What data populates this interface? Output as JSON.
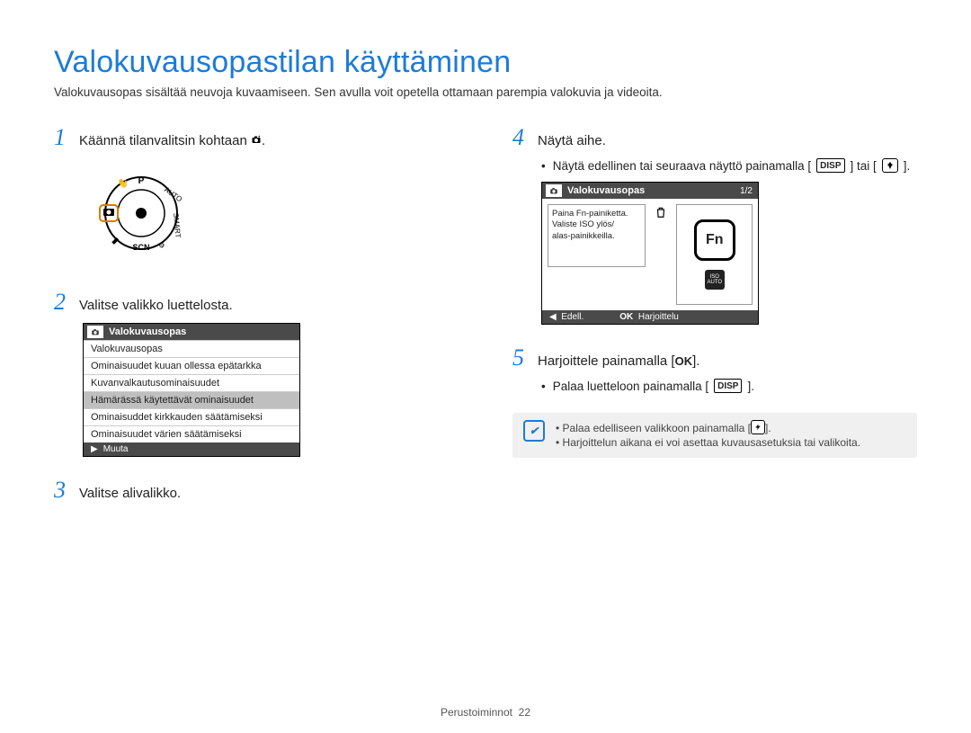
{
  "title": "Valokuvausopastilan käyttäminen",
  "intro": "Valokuvausopas sisältää neuvoja kuvaamiseen. Sen avulla voit opetella ottamaan parempia valokuvia ja videoita.",
  "steps": {
    "s1": {
      "num": "1",
      "text_a": "Käännä tilanvalitsin kohtaan ",
      "text_b": "."
    },
    "s2": {
      "num": "2",
      "text": "Valitse valikko luettelosta."
    },
    "s3": {
      "num": "3",
      "text": "Valitse alivalikko."
    },
    "s4": {
      "num": "4",
      "text": "Näytä aihe."
    },
    "s5": {
      "num": "5",
      "text_a": "Harjoittele painamalla [",
      "text_b": "]."
    }
  },
  "s4_bullet": {
    "a": "Näytä edellinen tai seuraava näyttö painamalla [",
    "b": "] tai [",
    "c": "]."
  },
  "s5_bullet": {
    "a": "Palaa luetteloon painamalla [",
    "b": "]."
  },
  "screen1": {
    "header": "Valokuvausopas",
    "rows": [
      "Valokuvausopas",
      "Ominaisuudet kuuan ollessa epätarkka",
      "Kuvanvalkautusominaisuudet",
      "Hämärässä käytettävät ominaisuudet",
      "Ominaisuddet kirkkauden säätämiseksi",
      "Ominaisuudet värien säätämiseksi"
    ],
    "selected_index": 3,
    "footer": "Muuta"
  },
  "screen2": {
    "header": "Valokuvausopas",
    "page": "1/2",
    "hint1": "Paina Fn-painiketta.",
    "hint2": "Valiste ISO ylös/",
    "hint3": "alas-painikkeilla.",
    "fn": "Fn",
    "iso1": "ISO",
    "iso2": "AUTO",
    "footer_left": "Edell.",
    "footer_right_lbl": "OK",
    "footer_right": "Harjoittelu"
  },
  "note": {
    "line1_a": "Palaa edelliseen valikkoon painamalla [",
    "line1_b": "].",
    "line2": "Harjoittelun aikana ei voi asettaa kuvausasetuksia tai valikoita."
  },
  "disp_label": "DISP",
  "ok_label": "OK",
  "footer": {
    "section": "Perustoiminnot",
    "page": "22"
  }
}
